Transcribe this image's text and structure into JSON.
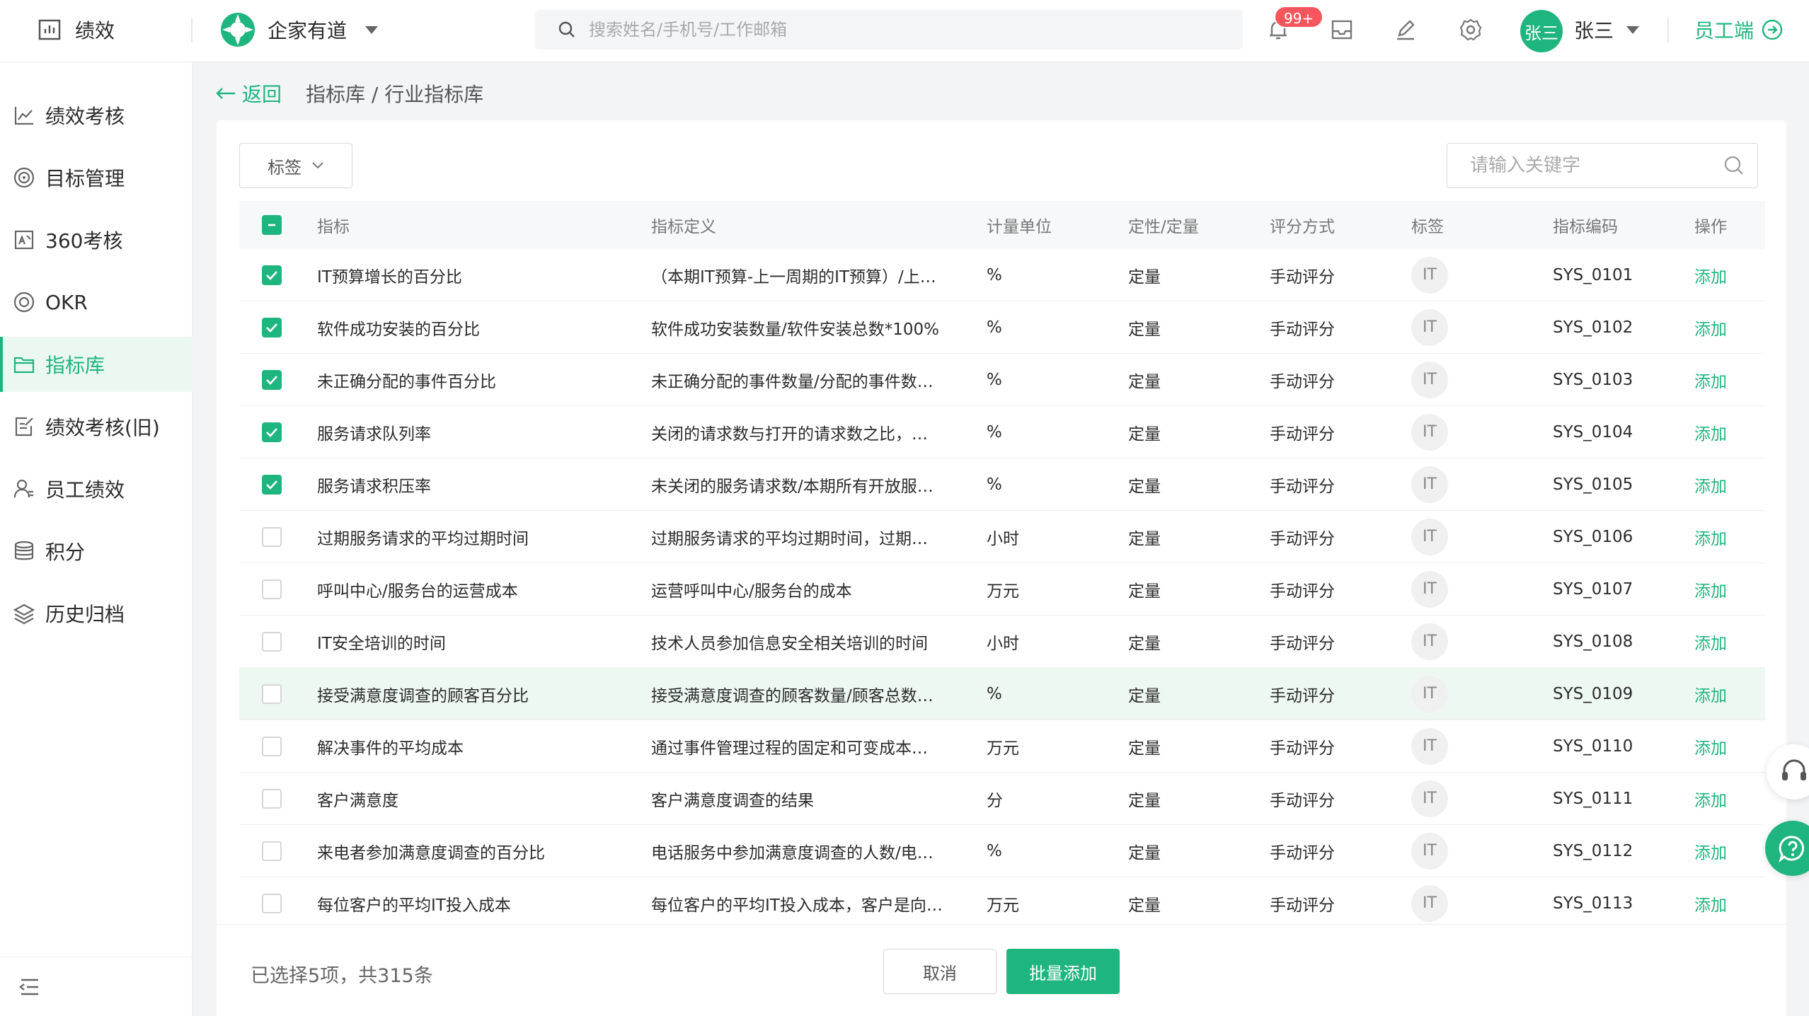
{
  "colors": {
    "accent": "#1fb57f",
    "badge": "#f5565e"
  },
  "topbar": {
    "module_title": "绩效",
    "company_name": "企家有道",
    "search_placeholder": "搜索姓名/手机号/工作邮箱",
    "notification_badge": "99+",
    "avatar_text": "张三",
    "user_name": "张三",
    "staff_portal": "员工端"
  },
  "sidebar": {
    "items": [
      {
        "label": "绩效考核",
        "icon": "line-chart-icon"
      },
      {
        "label": "目标管理",
        "icon": "target-icon"
      },
      {
        "label": "360考核",
        "icon": "review-icon"
      },
      {
        "label": "OKR",
        "icon": "okr-icon"
      },
      {
        "label": "指标库",
        "icon": "folder-icon"
      },
      {
        "label": "绩效考核(旧)",
        "icon": "document-edit-icon"
      },
      {
        "label": "员工绩效",
        "icon": "employee-icon"
      },
      {
        "label": "积分",
        "icon": "database-icon"
      },
      {
        "label": "历史归档",
        "icon": "layers-icon"
      }
    ],
    "active_index": 4
  },
  "breadcrumb": {
    "back": "返回",
    "path": "指标库 / 行业指标库"
  },
  "filters": {
    "tag_label": "标签",
    "keyword_placeholder": "请输入关键字"
  },
  "table": {
    "headers": [
      "指标",
      "指标定义",
      "计量单位",
      "定性/定量",
      "评分方式",
      "标签",
      "指标编码",
      "操作"
    ],
    "rows": [
      {
        "checked": true,
        "name": "IT预算增长的百分比",
        "definition": "（本期IT预算-上一周期的IT预算）/上…",
        "unit": "%",
        "type": "定量",
        "scoring": "手动评分",
        "tag": "IT",
        "code": "SYS_0101",
        "action": "添加"
      },
      {
        "checked": true,
        "name": "软件成功安装的百分比",
        "definition": "软件成功安装数量/软件安装总数*100%",
        "unit": "%",
        "type": "定量",
        "scoring": "手动评分",
        "tag": "IT",
        "code": "SYS_0102",
        "action": "添加"
      },
      {
        "checked": true,
        "name": "未正确分配的事件百分比",
        "definition": "未正确分配的事件数量/分配的事件数…",
        "unit": "%",
        "type": "定量",
        "scoring": "手动评分",
        "tag": "IT",
        "code": "SYS_0103",
        "action": "添加"
      },
      {
        "checked": true,
        "name": "服务请求队列率",
        "definition": "关闭的请求数与打开的请求数之比，…",
        "unit": "%",
        "type": "定量",
        "scoring": "手动评分",
        "tag": "IT",
        "code": "SYS_0104",
        "action": "添加"
      },
      {
        "checked": true,
        "name": "服务请求积压率",
        "definition": "未关闭的服务请求数/本期所有开放服…",
        "unit": "%",
        "type": "定量",
        "scoring": "手动评分",
        "tag": "IT",
        "code": "SYS_0105",
        "action": "添加"
      },
      {
        "checked": false,
        "name": "过期服务请求的平均过期时间",
        "definition": "过期服务请求的平均过期时间，过期…",
        "unit": "小时",
        "type": "定量",
        "scoring": "手动评分",
        "tag": "IT",
        "code": "SYS_0106",
        "action": "添加"
      },
      {
        "checked": false,
        "name": "呼叫中心/服务台的运营成本",
        "definition": "运营呼叫中心/服务台的成本",
        "unit": "万元",
        "type": "定量",
        "scoring": "手动评分",
        "tag": "IT",
        "code": "SYS_0107",
        "action": "添加"
      },
      {
        "checked": false,
        "name": "IT安全培训的时间",
        "definition": "技术人员参加信息安全相关培训的时间",
        "unit": "小时",
        "type": "定量",
        "scoring": "手动评分",
        "tag": "IT",
        "code": "SYS_0108",
        "action": "添加"
      },
      {
        "checked": false,
        "name": "接受满意度调查的顾客百分比",
        "definition": "接受满意度调查的顾客数量/顾客总数…",
        "unit": "%",
        "type": "定量",
        "scoring": "手动评分",
        "tag": "IT",
        "code": "SYS_0109",
        "action": "添加"
      },
      {
        "checked": false,
        "name": "解决事件的平均成本",
        "definition": "通过事件管理过程的固定和可变成本…",
        "unit": "万元",
        "type": "定量",
        "scoring": "手动评分",
        "tag": "IT",
        "code": "SYS_0110",
        "action": "添加"
      },
      {
        "checked": false,
        "name": "客户满意度",
        "definition": "客户满意度调查的结果",
        "unit": "分",
        "type": "定量",
        "scoring": "手动评分",
        "tag": "IT",
        "code": "SYS_0111",
        "action": "添加"
      },
      {
        "checked": false,
        "name": "来电者参加满意度调查的百分比",
        "definition": "电话服务中参加满意度调查的人数/电…",
        "unit": "%",
        "type": "定量",
        "scoring": "手动评分",
        "tag": "IT",
        "code": "SYS_0112",
        "action": "添加"
      },
      {
        "checked": false,
        "name": "每位客户的平均IT投入成本",
        "definition": "每位客户的平均IT投入成本，客户是向…",
        "unit": "万元",
        "type": "定量",
        "scoring": "手动评分",
        "tag": "IT",
        "code": "SYS_0113",
        "action": "添加"
      }
    ]
  },
  "footer": {
    "selection_info": "已选择5项，共315条",
    "cancel": "取消",
    "batch_add": "批量添加"
  }
}
